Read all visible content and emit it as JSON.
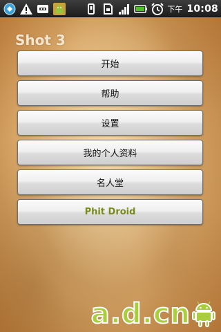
{
  "status_bar": {
    "ampm": "下午",
    "time": "10:08",
    "icons_left": [
      "sync-icon",
      "alert-icon",
      "usb-icon",
      "android-debug-icon"
    ],
    "icons_right": [
      "vibrate-icon",
      "sd-card-icon",
      "signal-icon",
      "battery-icon",
      "alarm-icon"
    ]
  },
  "screen": {
    "title": "Shot 3"
  },
  "menu": {
    "items": [
      {
        "label": "开始"
      },
      {
        "label": "帮助"
      },
      {
        "label": "设置"
      },
      {
        "label": "我的个人资料"
      },
      {
        "label": "名人堂"
      },
      {
        "label": "Phit Droid"
      }
    ],
    "accent_color": "#7a8a1c"
  },
  "watermark": {
    "text": "a.d.cn",
    "color": "#a9cd3b"
  }
}
